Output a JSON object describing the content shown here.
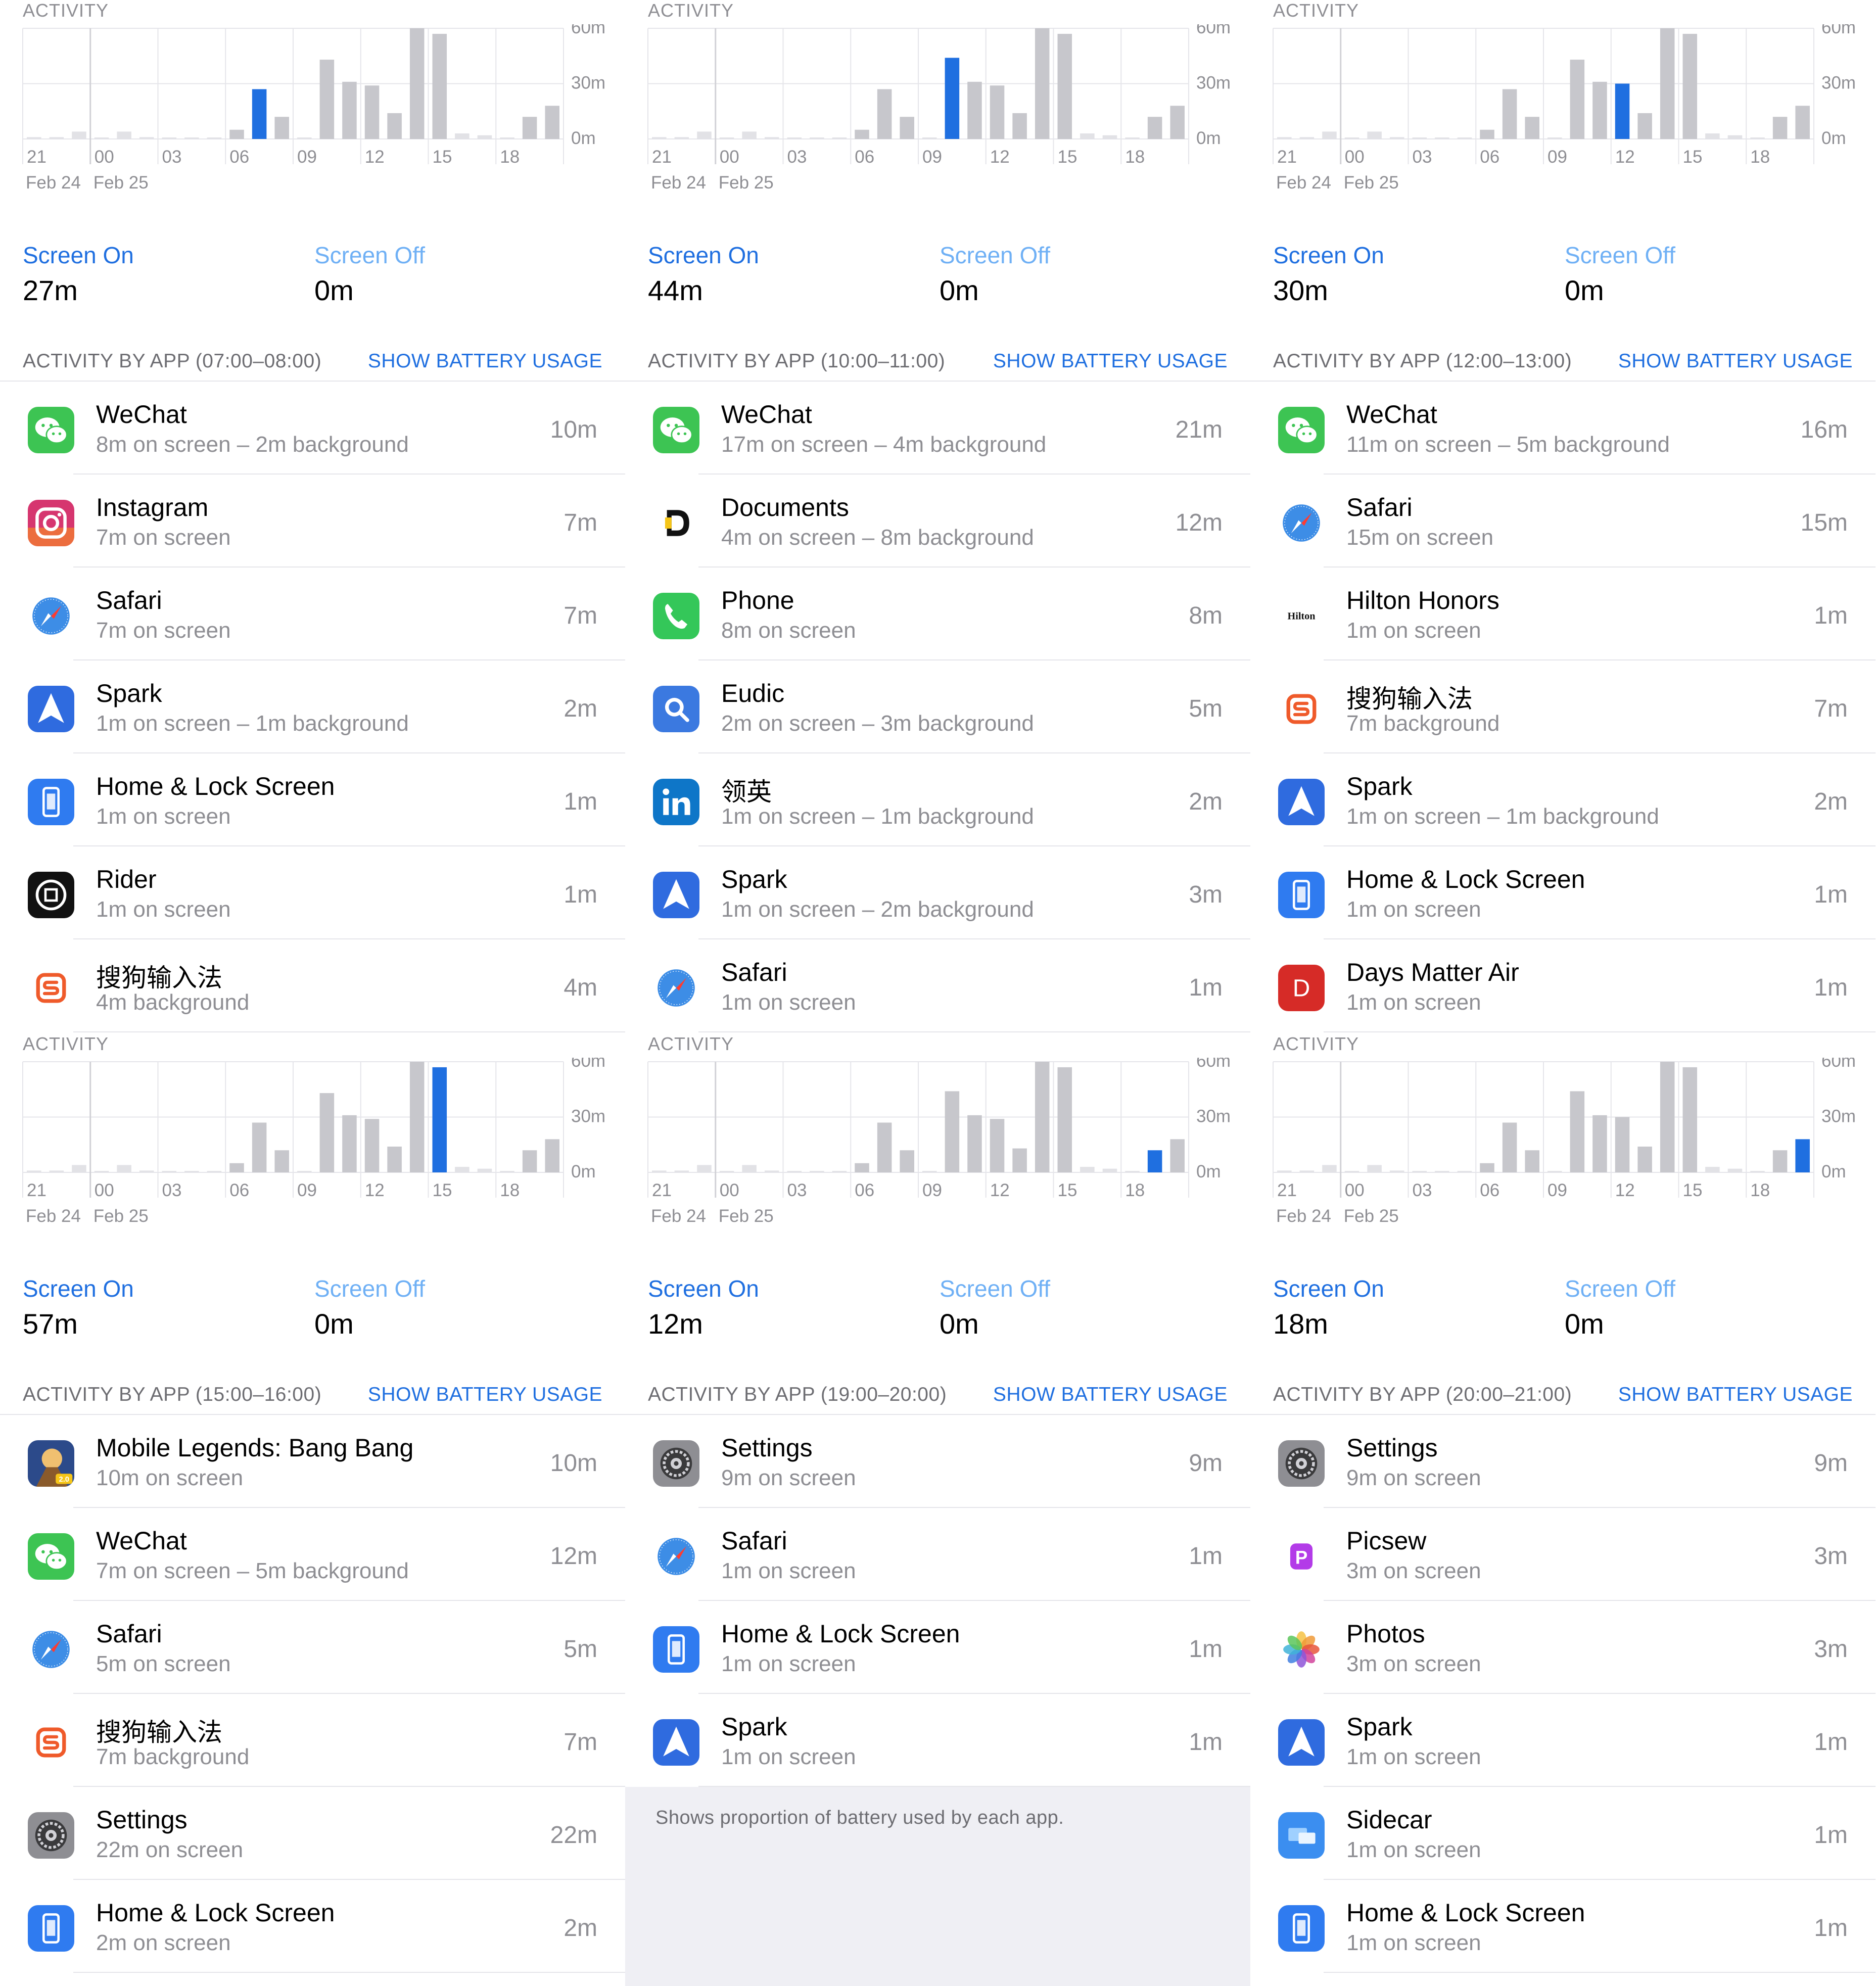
{
  "colors": {
    "accent": "#1f6fe0",
    "accent_light": "#6fb0f5",
    "bar": "#c7c7cc",
    "bar_light": "#e2e2e6",
    "grid": "#e5e5ea"
  },
  "panels": [
    {
      "activity_title": "ACTIVITY",
      "chart_data": {
        "type": "bar",
        "x_tick_labels": [
          "21",
          "00",
          "03",
          "06",
          "09",
          "12",
          "15",
          "18"
        ],
        "date_labels": [
          "Feb 24",
          "Feb 25"
        ],
        "y_tick_labels": [
          "60m",
          "30m",
          "0m"
        ],
        "ylim": [
          0,
          60
        ],
        "values": [
          1,
          1,
          4,
          0,
          4,
          1,
          0,
          0,
          0,
          5,
          27,
          12,
          0,
          43,
          31,
          29,
          14,
          60,
          57,
          3,
          2,
          0,
          12,
          18
        ],
        "highlight_index": 10
      },
      "screen_on_label": "Screen On",
      "screen_on_value": "27m",
      "screen_off_label": "Screen Off",
      "screen_off_value": "0m",
      "section_title": "ACTIVITY BY APP (07:00–08:00)",
      "battery_link": "SHOW BATTERY USAGE",
      "apps": [
        {
          "icon": "wechat-icon",
          "name": "WeChat",
          "detail": "8m on screen – 2m background",
          "total": "10m"
        },
        {
          "icon": "instagram-icon",
          "name": "Instagram",
          "detail": "7m on screen",
          "total": "7m"
        },
        {
          "icon": "safari-icon",
          "name": "Safari",
          "detail": "7m on screen",
          "total": "7m"
        },
        {
          "icon": "spark-icon",
          "name": "Spark",
          "detail": "1m on screen – 1m background",
          "total": "2m"
        },
        {
          "icon": "home-lock-screen-icon",
          "name": "Home & Lock Screen",
          "detail": "1m on screen",
          "total": "1m"
        },
        {
          "icon": "rider-icon",
          "name": "Rider",
          "detail": "1m on screen",
          "total": "1m"
        },
        {
          "icon": "sogou-icon",
          "name": "搜狗输入法",
          "detail": "4m background",
          "total": "4m"
        }
      ]
    },
    {
      "activity_title": "ACTIVITY",
      "chart_data": {
        "type": "bar",
        "x_tick_labels": [
          "21",
          "00",
          "03",
          "06",
          "09",
          "12",
          "15",
          "18"
        ],
        "date_labels": [
          "Feb 24",
          "Feb 25"
        ],
        "y_tick_labels": [
          "60m",
          "30m",
          "0m"
        ],
        "ylim": [
          0,
          60
        ],
        "values": [
          1,
          1,
          4,
          0,
          4,
          1,
          0,
          0,
          0,
          5,
          27,
          12,
          0,
          44,
          31,
          29,
          14,
          60,
          57,
          3,
          2,
          0,
          12,
          18
        ],
        "highlight_index": 13
      },
      "screen_on_label": "Screen On",
      "screen_on_value": "44m",
      "screen_off_label": "Screen Off",
      "screen_off_value": "0m",
      "section_title": "ACTIVITY BY APP (10:00–11:00)",
      "battery_link": "SHOW BATTERY USAGE",
      "apps": [
        {
          "icon": "wechat-icon",
          "name": "WeChat",
          "detail": "17m on screen – 4m background",
          "total": "21m"
        },
        {
          "icon": "documents-icon",
          "name": "Documents",
          "detail": "4m on screen – 8m background",
          "total": "12m"
        },
        {
          "icon": "phone-icon",
          "name": "Phone",
          "detail": "8m on screen",
          "total": "8m"
        },
        {
          "icon": "eudic-icon",
          "name": "Eudic",
          "detail": "2m on screen – 3m background",
          "total": "5m"
        },
        {
          "icon": "linkedin-icon",
          "name": "领英",
          "detail": "1m on screen – 1m background",
          "total": "2m"
        },
        {
          "icon": "spark-icon",
          "name": "Spark",
          "detail": "1m on screen – 2m background",
          "total": "3m"
        },
        {
          "icon": "safari-icon",
          "name": "Safari",
          "detail": "1m on screen",
          "total": "1m"
        }
      ]
    },
    {
      "activity_title": "ACTIVITY",
      "chart_data": {
        "type": "bar",
        "x_tick_labels": [
          "21",
          "00",
          "03",
          "06",
          "09",
          "12",
          "15",
          "18"
        ],
        "date_labels": [
          "Feb 24",
          "Feb 25"
        ],
        "y_tick_labels": [
          "60m",
          "30m",
          "0m"
        ],
        "ylim": [
          0,
          60
        ],
        "values": [
          1,
          1,
          4,
          0,
          4,
          1,
          0,
          0,
          0,
          5,
          27,
          12,
          0,
          43,
          31,
          30,
          14,
          60,
          57,
          3,
          2,
          0,
          12,
          18
        ],
        "highlight_index": 15
      },
      "screen_on_label": "Screen On",
      "screen_on_value": "30m",
      "screen_off_label": "Screen Off",
      "screen_off_value": "0m",
      "section_title": "ACTIVITY BY APP (12:00–13:00)",
      "battery_link": "SHOW BATTERY USAGE",
      "apps": [
        {
          "icon": "wechat-icon",
          "name": "WeChat",
          "detail": "11m on screen – 5m background",
          "total": "16m"
        },
        {
          "icon": "safari-icon",
          "name": "Safari",
          "detail": "15m on screen",
          "total": "15m"
        },
        {
          "icon": "hilton-icon",
          "name": "Hilton Honors",
          "detail": "1m on screen",
          "total": "1m",
          "icon_text": "Hilton"
        },
        {
          "icon": "sogou-icon",
          "name": "搜狗输入法",
          "detail": "7m background",
          "total": "7m"
        },
        {
          "icon": "spark-icon",
          "name": "Spark",
          "detail": "1m on screen – 1m background",
          "total": "2m"
        },
        {
          "icon": "home-lock-screen-icon",
          "name": "Home & Lock Screen",
          "detail": "1m on screen",
          "total": "1m"
        },
        {
          "icon": "days-matter-icon",
          "name": "Days Matter Air",
          "detail": "1m on screen",
          "total": "1m",
          "icon_text": "D"
        }
      ]
    },
    {
      "activity_title": "ACTIVITY",
      "chart_data": {
        "type": "bar",
        "x_tick_labels": [
          "21",
          "00",
          "03",
          "06",
          "09",
          "12",
          "15",
          "18"
        ],
        "date_labels": [
          "Feb 24",
          "Feb 25"
        ],
        "y_tick_labels": [
          "60m",
          "30m",
          "0m"
        ],
        "ylim": [
          0,
          60
        ],
        "values": [
          1,
          1,
          4,
          0,
          4,
          1,
          0,
          0,
          0,
          5,
          27,
          12,
          0,
          43,
          31,
          29,
          14,
          60,
          57,
          3,
          2,
          0,
          12,
          18
        ],
        "highlight_index": 18
      },
      "screen_on_label": "Screen On",
      "screen_on_value": "57m",
      "screen_off_label": "Screen Off",
      "screen_off_value": "0m",
      "section_title": "ACTIVITY BY APP (15:00–16:00)",
      "battery_link": "SHOW BATTERY USAGE",
      "apps": [
        {
          "icon": "mobile-legends-icon",
          "name": "Mobile Legends: Bang Bang",
          "detail": "10m on screen",
          "total": "10m",
          "icon_text": "2.0"
        },
        {
          "icon": "wechat-icon",
          "name": "WeChat",
          "detail": "7m on screen – 5m background",
          "total": "12m"
        },
        {
          "icon": "safari-icon",
          "name": "Safari",
          "detail": "5m on screen",
          "total": "5m"
        },
        {
          "icon": "sogou-icon",
          "name": "搜狗输入法",
          "detail": "7m background",
          "total": "7m"
        },
        {
          "icon": "settings-icon",
          "name": "Settings",
          "detail": "22m on screen",
          "total": "22m"
        },
        {
          "icon": "home-lock-screen-icon",
          "name": "Home & Lock Screen",
          "detail": "2m on screen",
          "total": "2m"
        }
      ]
    },
    {
      "activity_title": "ACTIVITY",
      "chart_data": {
        "type": "bar",
        "x_tick_labels": [
          "21",
          "00",
          "03",
          "06",
          "09",
          "12",
          "15",
          "18"
        ],
        "date_labels": [
          "Feb 24",
          "Feb 25"
        ],
        "y_tick_labels": [
          "60m",
          "30m",
          "0m"
        ],
        "ylim": [
          0,
          60
        ],
        "values": [
          1,
          1,
          4,
          0,
          4,
          1,
          0,
          0,
          0,
          5,
          27,
          12,
          0,
          44,
          31,
          29,
          13,
          60,
          57,
          3,
          2,
          0,
          12,
          18
        ],
        "highlight_index": 22
      },
      "screen_on_label": "Screen On",
      "screen_on_value": "12m",
      "screen_off_label": "Screen Off",
      "screen_off_value": "0m",
      "section_title": "ACTIVITY BY APP (19:00–20:00)",
      "battery_link": "SHOW BATTERY USAGE",
      "apps": [
        {
          "icon": "settings-icon",
          "name": "Settings",
          "detail": "9m on screen",
          "total": "9m"
        },
        {
          "icon": "safari-icon",
          "name": "Safari",
          "detail": "1m on screen",
          "total": "1m"
        },
        {
          "icon": "home-lock-screen-icon",
          "name": "Home & Lock Screen",
          "detail": "1m on screen",
          "total": "1m"
        },
        {
          "icon": "spark-icon",
          "name": "Spark",
          "detail": "1m on screen",
          "total": "1m"
        }
      ],
      "footer_text": "Shows proportion of battery used by each app."
    },
    {
      "activity_title": "ACTIVITY",
      "chart_data": {
        "type": "bar",
        "x_tick_labels": [
          "21",
          "00",
          "03",
          "06",
          "09",
          "12",
          "15",
          "18"
        ],
        "date_labels": [
          "Feb 24",
          "Feb 25"
        ],
        "y_tick_labels": [
          "60m",
          "30m",
          "0m"
        ],
        "ylim": [
          0,
          60
        ],
        "values": [
          1,
          1,
          4,
          0,
          4,
          1,
          0,
          0,
          0,
          5,
          27,
          12,
          0,
          44,
          31,
          30,
          14,
          60,
          57,
          3,
          2,
          0,
          12,
          18
        ],
        "highlight_index": 23
      },
      "screen_on_label": "Screen On",
      "screen_on_value": "18m",
      "screen_off_label": "Screen Off",
      "screen_off_value": "0m",
      "section_title": "ACTIVITY BY APP (20:00–21:00)",
      "battery_link": "SHOW BATTERY USAGE",
      "apps": [
        {
          "icon": "settings-icon",
          "name": "Settings",
          "detail": "9m on screen",
          "total": "9m"
        },
        {
          "icon": "picsew-icon",
          "name": "Picsew",
          "detail": "3m on screen",
          "total": "3m",
          "icon_text": "P"
        },
        {
          "icon": "photos-icon",
          "name": "Photos",
          "detail": "3m on screen",
          "total": "3m"
        },
        {
          "icon": "spark-icon",
          "name": "Spark",
          "detail": "1m on screen",
          "total": "1m"
        },
        {
          "icon": "sidecar-icon",
          "name": "Sidecar",
          "detail": "1m on screen",
          "total": "1m"
        },
        {
          "icon": "home-lock-screen-icon",
          "name": "Home & Lock Screen",
          "detail": "1m on screen",
          "total": "1m"
        }
      ]
    }
  ]
}
